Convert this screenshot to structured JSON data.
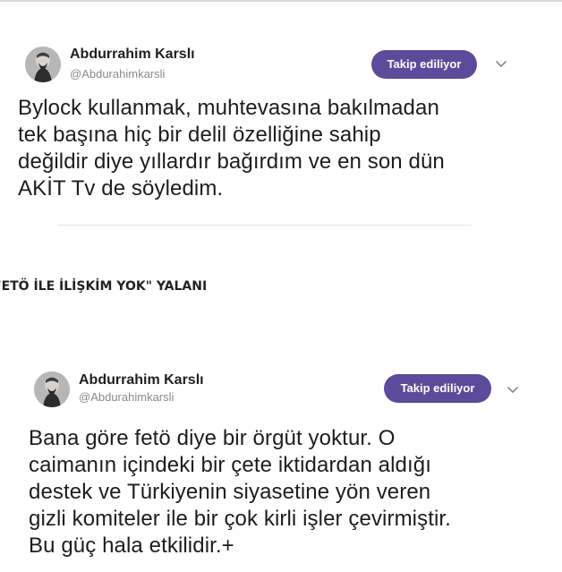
{
  "tweets": [
    {
      "author": {
        "name": "Abdurrahim Karslı",
        "handle": "@Abdurahimkarsli"
      },
      "follow_label": "Takip ediliyor",
      "text_lines": [
        "Bylock kullanmak, muhtevasına bakılmadan",
        "tek başına hiç bir delil özelliğine sahip",
        "değildir diye yıllardır bağırdım ve en son dün",
        "AKİT Tv de söyledim."
      ]
    },
    {
      "author": {
        "name": "Abdurrahim Karslı",
        "handle": "@Abdurahimkarsli"
      },
      "follow_label": "Takip ediliyor",
      "text_lines": [
        "Bana göre fetö diye bir örgüt yoktur. O",
        "caimanın içindeki bir çete iktidardan aldığı",
        "destek ve Türkiyenin siyasetine yön veren",
        "gizli komiteler ile bir çok kirli işler çevirmiştir.",
        "Bu güç hala etkilidir.+"
      ]
    }
  ],
  "section_heading": "FETÖ İLE İLİŞKİM YOK\" YALANI",
  "colors": {
    "follow_button_bg": "#5c4b9a",
    "follow_button_text": "#ffffff",
    "name_text": "#1f1f1f",
    "handle_text": "#8a8a8a",
    "body_text": "#1d1d1d"
  },
  "icons": {
    "avatar": "avatar-portrait",
    "menu": "chevron-down-icon"
  }
}
